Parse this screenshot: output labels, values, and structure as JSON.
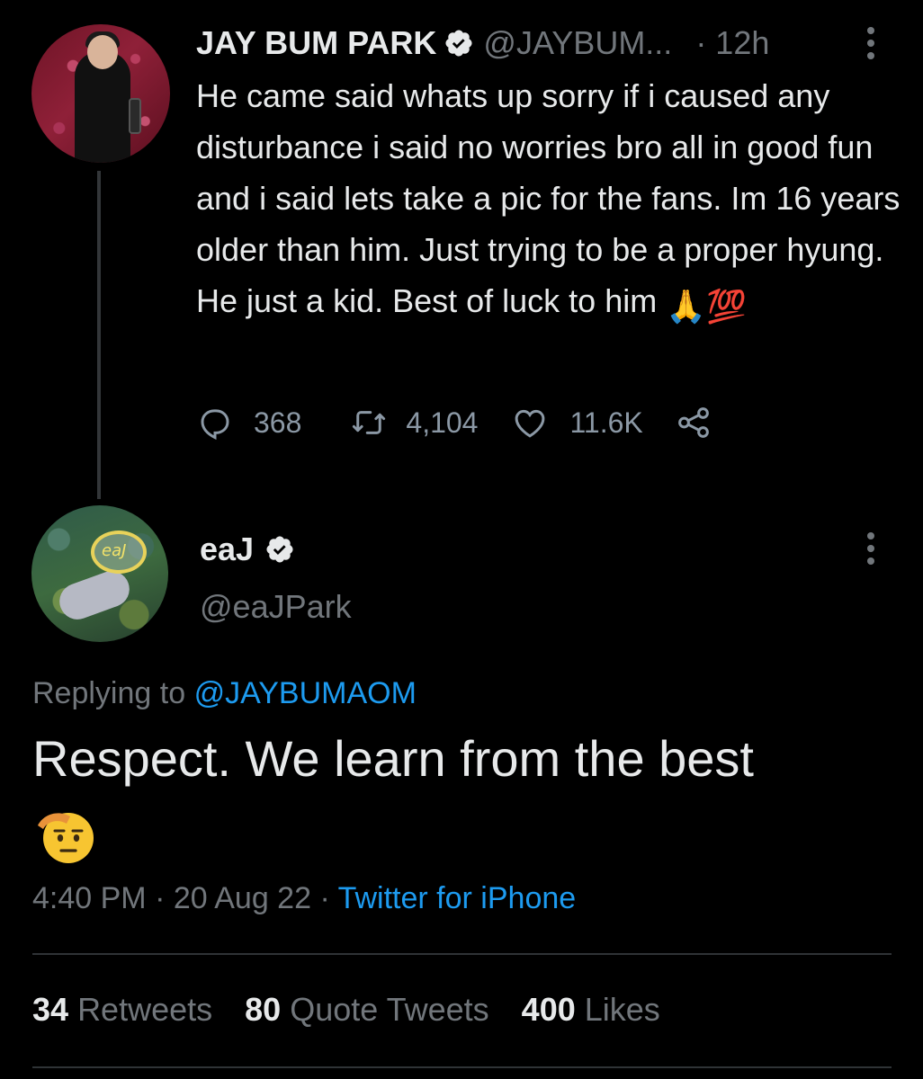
{
  "parent_tweet": {
    "display_name": "JAY BUM PARK",
    "handle": "@JAYBUM...",
    "time": "· 12h",
    "text": "He came said whats up sorry if i caused any disturbance i said no worries bro all in good fun and i said lets take a pic for the fans. Im 16 years older than him. Just trying to be a proper hyung. He just a kid. Best of luck to him",
    "emojis": [
      "🙏",
      "💯"
    ],
    "reply_count": "368",
    "retweet_count": "4,104",
    "like_count": "11.6K",
    "icons": [
      "reply-icon",
      "retweet-icon",
      "like-icon",
      "share-icon",
      "verified-icon",
      "more-icon"
    ]
  },
  "reply_tweet": {
    "display_name": "eaJ",
    "handle": "@eaJPark",
    "replying_prefix": "Replying to",
    "replying_mention": "@JAYBUMAOM",
    "text": "Respect. We learn from the best",
    "emoji": "🫡",
    "time": "4:40 PM",
    "date": "20 Aug 22",
    "separator": " · ",
    "source": "Twitter for iPhone",
    "avatar_mark": "eaJ"
  },
  "stats": {
    "retweets_count": "34",
    "retweets_label": "Retweets",
    "quotes_count": "80",
    "quotes_label": "Quote Tweets",
    "likes_count": "400",
    "likes_label": "Likes"
  },
  "colors": {
    "background": "#000000",
    "text": "#e7e9ea",
    "secondary": "#71767b",
    "link": "#1d9bf0",
    "divider": "#2f3336"
  }
}
